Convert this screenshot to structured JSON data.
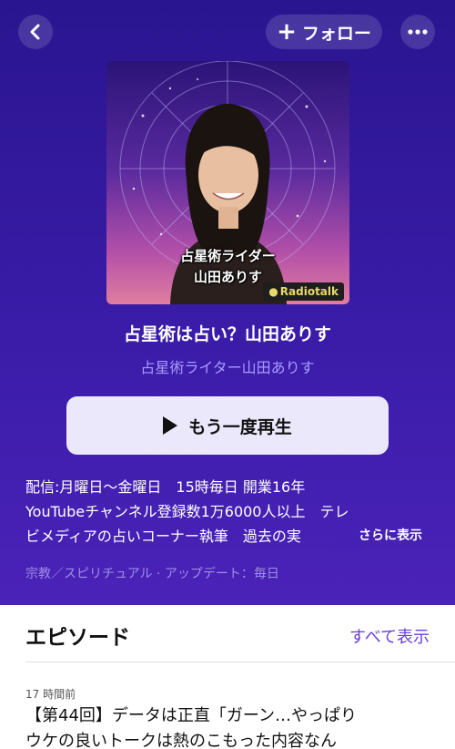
{
  "header": {
    "follow_label": "フォロー",
    "icons": {
      "back": "chevron-left-icon",
      "plus": "plus-icon",
      "more": "ellipsis-icon"
    }
  },
  "artwork": {
    "caption_line1": "占星術ライダー",
    "caption_line2": "山田ありす",
    "badge": "Radiotalk"
  },
  "program": {
    "title": "占星術は占い？山田ありす",
    "author": "占星術ライター山田ありす",
    "play_label": "もう一度再生",
    "description_lines": [
      "配信:月曜日〜金曜日　15時毎日 開業16年",
      "YouTubeチャンネル登録数1万6000人以上　テレ",
      "ビメディアの占いコーナー執筆　過去の実"
    ],
    "more_label": "さらに表示",
    "meta": "宗教／スピリチュアル · アップデート：毎日"
  },
  "episodes": {
    "heading": "エピソード",
    "see_all": "すべて表示",
    "items": [
      {
        "time": "17 時間前",
        "title_line1": "【第44回】データは正直「ガーン…やっぱり",
        "title_line2": "ウケの良いトークは熱のこもった内容なん"
      }
    ]
  },
  "colors": {
    "hero_bg": "#3a1ca8",
    "author_text": "#a99bff",
    "link": "#6a3fd8",
    "play_button_bg": "#ece8fb"
  }
}
